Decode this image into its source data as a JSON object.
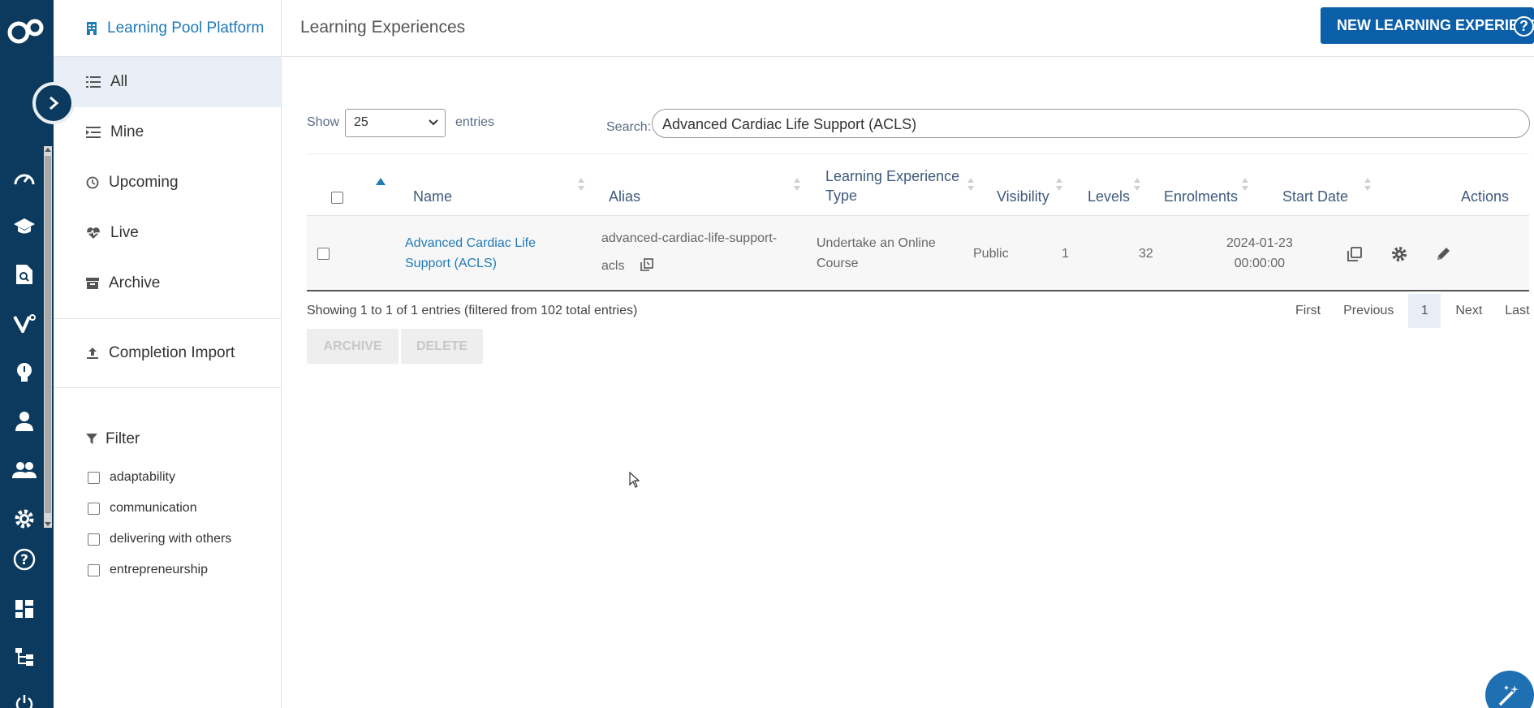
{
  "sidebar": {
    "header": "Learning Pool Platform",
    "nav": [
      {
        "label": "All",
        "active": true
      },
      {
        "label": "Mine"
      },
      {
        "label": "Upcoming"
      },
      {
        "label": "Live"
      },
      {
        "label": "Archive"
      }
    ],
    "completion_import": "Completion Import",
    "filter": {
      "title": "Filter",
      "options": [
        "adaptability",
        "communication",
        "delivering with others",
        "entrepreneurship"
      ]
    }
  },
  "header": {
    "title": "Learning Experiences",
    "new_button": "NEW LEARNING EXPERIENCE",
    "help": "?"
  },
  "controls": {
    "show_label": "Show",
    "page_size": "25",
    "entries_label": "entries",
    "search_label": "Search:",
    "search_value": "Advanced Cardiac Life Support (ACLS)"
  },
  "table": {
    "columns": {
      "name": "Name",
      "alias": "Alias",
      "type_line1": "Learning Experience",
      "type_line2": "Type",
      "visibility": "Visibility",
      "levels": "Levels",
      "enrolments": "Enrolments",
      "start_date": "Start Date",
      "actions": "Actions"
    },
    "rows": [
      {
        "name_line1": "Advanced Cardiac Life",
        "name_line2": "Support (ACLS)",
        "alias_line1": "advanced-cardiac-life-support-",
        "alias_line2": "acls",
        "type_line1": "Undertake an Online",
        "type_line2": "Course",
        "visibility": "Public",
        "levels": "1",
        "enrolments": "32",
        "start_line1": "2024-01-23",
        "start_line2": "00:00:00"
      }
    ]
  },
  "footer": {
    "info": "Showing 1 to 1 of 1 entries (filtered from 102 total entries)",
    "pager": {
      "first": "First",
      "previous": "Previous",
      "current": "1",
      "next": "Next",
      "last": "Last"
    },
    "archive": "ARCHIVE",
    "delete": "DELETE"
  },
  "colors": {
    "rail": "#0b3a5e",
    "accent": "#1f7ab8",
    "primary_button": "#0b5ea8"
  },
  "icons": [
    "logo-icon",
    "chevron-right-icon",
    "dashboard-icon",
    "graduation-cap-icon",
    "document-search-icon",
    "v-brand-icon",
    "lightbulb-icon",
    "person-icon",
    "people-icon",
    "gear-icon",
    "help-circle-icon",
    "grid-icon",
    "hierarchy-icon",
    "power-icon",
    "building-icon",
    "list-icon",
    "clock-icon",
    "heartbeat-icon",
    "archive-box-icon",
    "upload-icon",
    "funnel-icon",
    "copy-icon",
    "pencil-icon",
    "magic-wand-icon"
  ]
}
